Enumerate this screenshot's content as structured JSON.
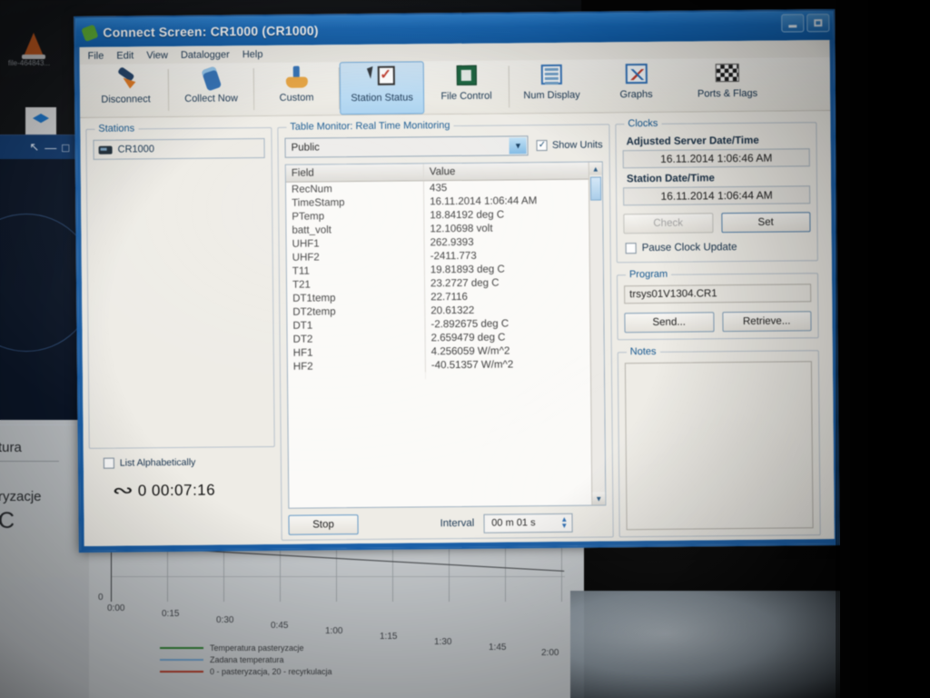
{
  "window": {
    "title": "Connect Screen: CR1000 (CR1000)",
    "app_icon": "leaf-icon",
    "minimize_label": "—",
    "maximize_label": "□"
  },
  "menubar": {
    "items": [
      {
        "label": "File"
      },
      {
        "label": "Edit"
      },
      {
        "label": "View"
      },
      {
        "label": "Datalogger"
      },
      {
        "label": "Help"
      }
    ]
  },
  "toolbar": {
    "items": [
      {
        "label": "Disconnect",
        "icon": "plug-disconnect-icon",
        "active": false
      },
      {
        "label": "Collect Now",
        "icon": "handheld-collect-icon",
        "active": false
      },
      {
        "label": "Custom",
        "icon": "custom-crown-icon",
        "active": false
      },
      {
        "label": "Station Status",
        "icon": "station-status-checklist-icon",
        "active": true
      },
      {
        "label": "File Control",
        "icon": "file-control-icon",
        "active": false
      },
      {
        "label": "Num Display",
        "icon": "num-display-icon",
        "active": false
      },
      {
        "label": "Graphs",
        "icon": "graphs-icon",
        "active": false
      },
      {
        "label": "Ports & Flags",
        "icon": "checkered-flags-icon",
        "active": false
      }
    ]
  },
  "stations": {
    "legend": "Stations",
    "items": [
      {
        "name": "CR1000",
        "icon": "datalogger-icon"
      }
    ],
    "list_alphabetically": {
      "label": "List Alphabetically",
      "checked": false
    },
    "timer": {
      "icon": "elapsed-time-icon",
      "value": "0 00:07:16"
    }
  },
  "monitor": {
    "legend": "Table Monitor: Real Time Monitoring",
    "table_select": {
      "value": "Public",
      "arrow": "▼"
    },
    "show_units": {
      "label": "Show Units",
      "checked": true
    },
    "columns": [
      "Field",
      "Value"
    ],
    "rows": [
      {
        "field": "RecNum",
        "value": "435"
      },
      {
        "field": "TimeStamp",
        "value": "16.11.2014 1:06:44 AM"
      },
      {
        "field": "PTemp",
        "value": "18.84192 deg C"
      },
      {
        "field": "batt_volt",
        "value": "12.10698 volt"
      },
      {
        "field": "UHF1",
        "value": "262.9393"
      },
      {
        "field": "UHF2",
        "value": "-2411.773"
      },
      {
        "field": "T11",
        "value": "19.81893 deg C"
      },
      {
        "field": "T21",
        "value": "23.2727 deg C"
      },
      {
        "field": "DT1temp",
        "value": "22.7116"
      },
      {
        "field": "DT2temp",
        "value": "20.61322"
      },
      {
        "field": "DT1",
        "value": "-2.892675 deg C"
      },
      {
        "field": "DT2",
        "value": "2.659479 deg C"
      },
      {
        "field": "HF1",
        "value": "4.256059 W/m^2"
      },
      {
        "field": "HF2",
        "value": "-40.51357 W/m^2"
      }
    ],
    "scrollbar": {
      "up": "▲",
      "down": "▼"
    },
    "stop_button": "Stop",
    "interval_label": "Interval",
    "interval_value": "00 m 01 s",
    "spinner_up": "▲",
    "spinner_down": "▼"
  },
  "clocks": {
    "legend": "Clocks",
    "adjusted_label": "Adjusted Server Date/Time",
    "adjusted_value": "16.11.2014 1:06:46 AM",
    "station_label": "Station Date/Time",
    "station_value": "16.11.2014 1:06:44 AM",
    "check_button": "Check",
    "set_button": "Set",
    "pause_clock": {
      "label": "Pause Clock Update",
      "checked": false
    }
  },
  "program": {
    "legend": "Program",
    "file": "trsys01V1304.CR1",
    "send_button": "Send...",
    "retrieve_button": "Retrieve..."
  },
  "notes": {
    "legend": "Notes",
    "value": ""
  },
  "background_window": {
    "close_label": "✕",
    "minimize_label": "—",
    "maximize_label": "□",
    "restore_label": "↖"
  },
  "desktop": {
    "icons": [
      {
        "label": "file-464843...",
        "icon": "vlc-cone-icon"
      },
      {
        "label": "",
        "icon": "dropbox-icon"
      }
    ]
  },
  "document_sheet": {
    "lines": [
      "tura",
      "ryzacje"
    ],
    "big": "C"
  },
  "chart_data": {
    "type": "line",
    "title": "",
    "xlabel": "",
    "ylabel": "",
    "x": [
      "0:00",
      "0:15",
      "0:30",
      "0:45",
      "1:00",
      "1:15",
      "1:30",
      "1:45",
      "2:00"
    ],
    "ytick_labels": [
      "0"
    ],
    "ylim": [
      0,
      0
    ],
    "grid": true,
    "legend_position": "below-axis",
    "series": [
      {
        "name": "Temperatura pasteryzacje",
        "color": "#2e7d32",
        "values": [
          0,
          0,
          0,
          0,
          0,
          0,
          0,
          0,
          0
        ]
      },
      {
        "name": "Zadana temperatura",
        "color": "#6f9fc9",
        "values": [
          0,
          0,
          0,
          0,
          0,
          0,
          0,
          0,
          0
        ]
      },
      {
        "name": "0 - pasteryzacja, 20 - recyrkulacja",
        "color": "#b03b2a",
        "values": [
          0,
          0,
          0,
          0,
          0,
          0,
          0,
          0,
          0
        ]
      }
    ]
  },
  "colors": {
    "title_blue": "#1668b8",
    "window_border": "#1a5fa8",
    "group_legend": "#13568f",
    "active_tab": "#a9d2f0"
  }
}
